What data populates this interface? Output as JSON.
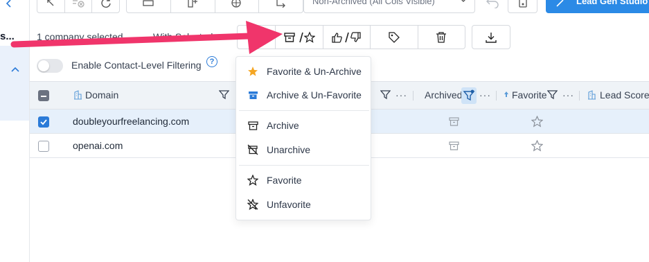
{
  "sidebar": {
    "back_icon": "chevron-left-icon",
    "title_fragment": "s...",
    "expand_icon": "chevron-up-icon"
  },
  "toolbar": {
    "tool_icons": [
      "collapse-icon",
      "clear-filter-icon",
      "refresh-icon",
      "row-height-icon",
      "add-column-icon",
      "globe-icon",
      "swap-icon"
    ],
    "view_select": "Non-Archived (All Cols Visible)",
    "undo_icon": "undo-icon",
    "settings_icon": "column-settings-icon",
    "lead_gen_label": "Lead Gen Studio",
    "lead_gen_icon": "magic-wand-icon"
  },
  "selection": {
    "count_text": "1 company selected",
    "with_selected_text": "With Selected",
    "actions": {
      "archive_favorite": {
        "icon": "archive-star-icon",
        "label": "/"
      },
      "like_dislike": {
        "icon": "thumbs-up-down-icon",
        "label": "/"
      },
      "tag_icon": "tag-icon",
      "delete_icon": "trash-icon",
      "download_icon": "download-icon"
    }
  },
  "filters": {
    "toggle_label": "Enable Contact-Level Filtering",
    "toggle_on": false,
    "help_icon": "question-circle-icon",
    "help_glyph": "?"
  },
  "table": {
    "columns": [
      {
        "label": "Domain",
        "icon": "building-icon"
      },
      {
        "label": "Archived"
      },
      {
        "label": "Favorite",
        "icon": "sort-up-icon"
      },
      {
        "label": "Lead Score",
        "icon": "building-icon"
      }
    ],
    "more_glyph": "···",
    "rows": [
      {
        "domain": "doubleyourfreelancing.com",
        "selected": true
      },
      {
        "domain": "openai.com",
        "selected": false
      }
    ]
  },
  "menu": {
    "items": [
      {
        "label": "Favorite & Un-Archive",
        "icon": "star-filled-icon",
        "color": "#f5a623"
      },
      {
        "label": "Archive & Un-Favorite",
        "icon": "archive-filled-icon",
        "color": "#2b7bd8"
      },
      {
        "label": "Archive",
        "icon": "archive-icon"
      },
      {
        "label": "Unarchive",
        "icon": "unarchive-icon"
      },
      {
        "label": "Favorite",
        "icon": "star-outline-icon"
      },
      {
        "label": "Unfavorite",
        "icon": "unfavorite-icon"
      }
    ]
  },
  "annotation": {
    "arrow_color": "#f0356b"
  },
  "colors": {
    "accent": "#2b7bd8",
    "header_bg": "#eff3f7",
    "selected_row": "#e6f0fb"
  }
}
